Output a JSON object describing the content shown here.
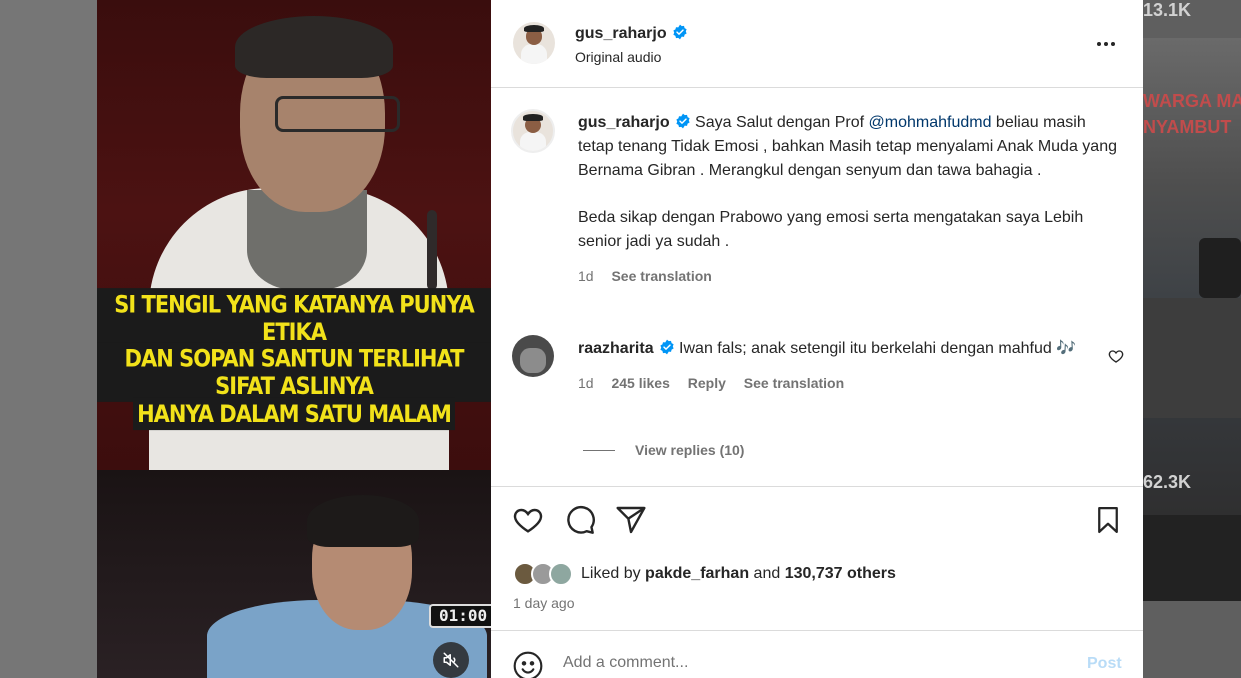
{
  "background": {
    "top_count": "13.1K",
    "bottom_count": "62.3K",
    "headline_lines": [
      "WARGA MA",
      "NYAMBUT"
    ]
  },
  "video": {
    "caption_lines": [
      "SI TENGIL YANG KATANYA PUNYA ETIKA",
      "DAN SOPAN SANTUN TERLIHAT SIFAT ASLINYA",
      "HANYA DALAM SATU MALAM"
    ],
    "timecode": "01:00",
    "mute_icon": "speaker-muted-icon"
  },
  "post": {
    "username": "gus_raharjo",
    "audio": "Original audio",
    "caption": {
      "username": "gus_raharjo",
      "pre": "Saya Salut dengan Prof ",
      "mention": "@mohmahfudmd",
      "post": " beliau masih tetap tenang Tidak Emosi , bahkan Masih tetap menyalami Anak Muda yang Bernama Gibran . Merangkul dengan senyum dan tawa bahagia .",
      "para2": "Beda sikap dengan Prabowo yang emosi serta mengatakan saya Lebih senior jadi ya sudah .",
      "time": "1d",
      "see_translation": "See translation"
    },
    "comment": {
      "username": "raazharita",
      "text": "Iwan fals; anak setengil itu berkelahi dengan mahfud 🎶",
      "time": "1d",
      "likes": "245 likes",
      "reply": "Reply",
      "see_translation": "See translation",
      "view_replies": "View replies (10)"
    },
    "likes": {
      "liked_by": "Liked by",
      "user": "pakde_farhan",
      "and": "and",
      "others": "130,737 others"
    },
    "time_ago": "1 day ago",
    "add_comment_placeholder": "Add a comment...",
    "post_label": "Post"
  },
  "colors": {
    "verified": "#0095f6",
    "mention": "#00376b",
    "post_disabled": "#b9dcf7",
    "caption_yellow": "#f2e21a"
  }
}
